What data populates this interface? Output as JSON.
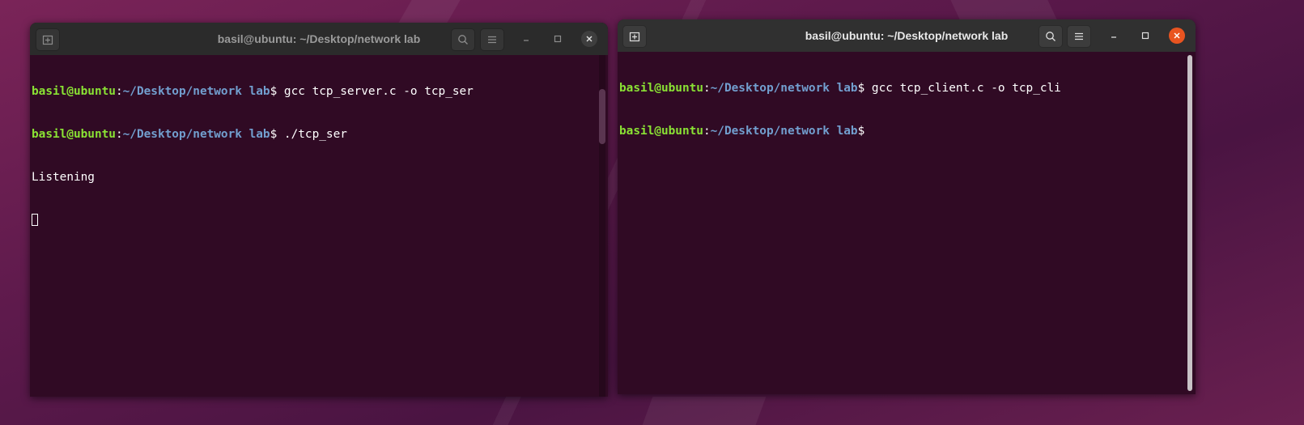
{
  "colors": {
    "terminal_bg": "#300a24",
    "prompt_user": "#8ae234",
    "prompt_path": "#729fcf",
    "text": "#ffffff",
    "close_active": "#e95420"
  },
  "windows": [
    {
      "title": "basil@ubuntu: ~/Desktop/network lab",
      "state": "inactive",
      "lines": [
        {
          "type": "prompt",
          "user": "basil@ubuntu",
          "sep": ":",
          "path": "~/Desktop/network lab",
          "symbol": "$ ",
          "command": "gcc tcp_server.c -o tcp_ser"
        },
        {
          "type": "prompt",
          "user": "basil@ubuntu",
          "sep": ":",
          "path": "~/Desktop/network lab",
          "symbol": "$ ",
          "command": "./tcp_ser"
        },
        {
          "type": "output",
          "text": "Listening"
        }
      ],
      "icons": [
        "new-tab-icon",
        "search-icon",
        "hamburger-menu-icon",
        "minimize-icon",
        "maximize-icon",
        "close-icon"
      ]
    },
    {
      "title": "basil@ubuntu: ~/Desktop/network lab",
      "state": "active",
      "lines": [
        {
          "type": "prompt",
          "user": "basil@ubuntu",
          "sep": ":",
          "path": "~/Desktop/network lab",
          "symbol": "$ ",
          "command": "gcc tcp_client.c -o tcp_cli"
        },
        {
          "type": "prompt",
          "user": "basil@ubuntu",
          "sep": ":",
          "path": "~/Desktop/network lab",
          "symbol": "$",
          "command": ""
        }
      ],
      "icons": [
        "new-tab-icon",
        "search-icon",
        "hamburger-menu-icon",
        "minimize-icon",
        "maximize-icon",
        "close-icon"
      ]
    }
  ]
}
